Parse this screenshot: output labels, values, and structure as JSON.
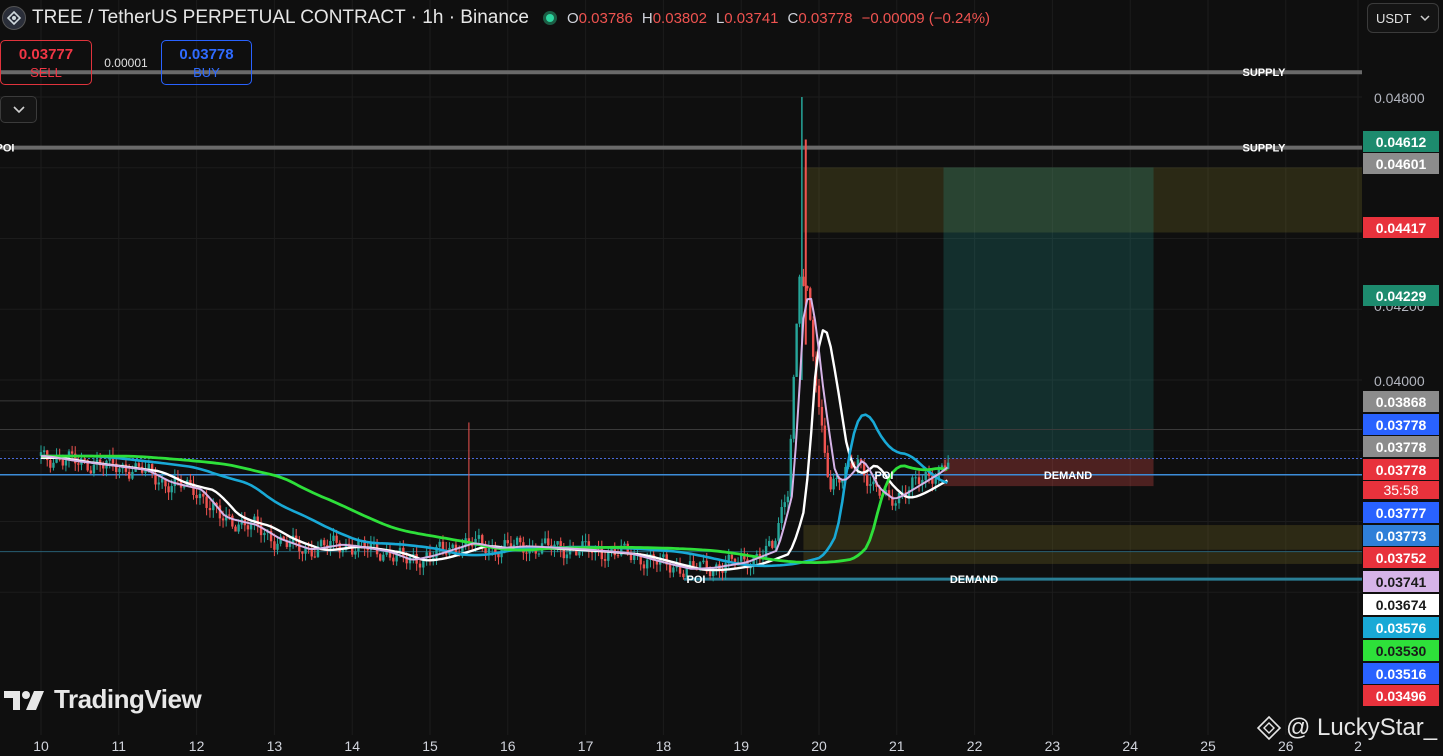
{
  "header": {
    "title": "TREE / TetherUS PERPETUAL CONTRACT · 1h · Binance",
    "ohlc": [
      {
        "key": "O",
        "value": "0.03786"
      },
      {
        "key": "H",
        "value": "0.03802"
      },
      {
        "key": "L",
        "value": "0.03741"
      },
      {
        "key": "C",
        "value": "0.03778"
      }
    ],
    "change": "−0.00009 (−0.24%)",
    "currency": "USDT"
  },
  "trade": {
    "sell_price": "0.03777",
    "sell_label": "SELL",
    "buy_price": "0.03778",
    "buy_label": "BUY",
    "spread": "0.00001"
  },
  "branding": {
    "logo_text": "TradingView",
    "watermark": "@ LuckyStar_"
  },
  "countdown": "35:58",
  "price_labels": [
    {
      "value": "0.04612",
      "bg": "#1d8b6e",
      "fg": "#ffffff"
    },
    {
      "value": "0.04601",
      "bg": "#8c8c8c",
      "fg": "#ffffff"
    },
    {
      "value": "0.04417",
      "bg": "#e8323c",
      "fg": "#ffffff"
    },
    {
      "value": "0.04229",
      "bg": "#1d8b6e",
      "fg": "#ffffff"
    },
    {
      "value": "0.03868",
      "bg": "#8c8c8c",
      "fg": "#ffffff"
    },
    {
      "value": "0.03778",
      "bg": "#2962ff",
      "fg": "#ffffff"
    },
    {
      "value": "0.03778",
      "bg": "#8c8c8c",
      "fg": "#ffffff"
    },
    {
      "value": "0.03778",
      "bg": "#e8323c",
      "fg": "#ffffff"
    },
    {
      "value": "0.03777",
      "bg": "#2962ff",
      "fg": "#ffffff"
    },
    {
      "value": "0.03773",
      "bg": "#2f7fd8",
      "fg": "#ffffff"
    },
    {
      "value": "0.03752",
      "bg": "#e8323c",
      "fg": "#ffffff"
    },
    {
      "value": "0.03741",
      "bg": "#d6b4e8",
      "fg": "#1a1a1a"
    },
    {
      "value": "0.03674",
      "bg": "#ffffff",
      "fg": "#1a1a1a"
    },
    {
      "value": "0.03576",
      "bg": "#19a9d6",
      "fg": "#ffffff"
    },
    {
      "value": "0.03530",
      "bg": "#2ee03a",
      "fg": "#1a1a1a"
    },
    {
      "value": "0.03516",
      "bg": "#2962ff",
      "fg": "#ffffff"
    },
    {
      "value": "0.03496",
      "bg": "#e8323c",
      "fg": "#ffffff"
    }
  ],
  "chart_data": {
    "type": "candlestick",
    "symbol": "TREE / TetherUS PERPETUAL CONTRACT",
    "interval": "1h",
    "exchange": "Binance",
    "y_ticks": [
      "0.04800",
      "0.04200",
      "0.04000"
    ],
    "x_ticks": [
      "10",
      "11",
      "12",
      "13",
      "14",
      "15",
      "16",
      "17",
      "18",
      "19",
      "20",
      "21",
      "22",
      "23",
      "24",
      "25",
      "26",
      "2"
    ],
    "ylim": [
      0.0345,
      0.0485
    ],
    "close_series": [
      {
        "day": 10.0,
        "price": 0.03785
      },
      {
        "day": 10.4,
        "price": 0.0377
      },
      {
        "day": 10.8,
        "price": 0.0376
      },
      {
        "day": 11.3,
        "price": 0.03745
      },
      {
        "day": 11.6,
        "price": 0.0371
      },
      {
        "day": 12.0,
        "price": 0.0369
      },
      {
        "day": 12.3,
        "price": 0.0361
      },
      {
        "day": 12.7,
        "price": 0.0359
      },
      {
        "day": 13.0,
        "price": 0.0355
      },
      {
        "day": 13.4,
        "price": 0.0352
      },
      {
        "day": 13.8,
        "price": 0.03535
      },
      {
        "day": 14.0,
        "price": 0.0353
      },
      {
        "day": 14.4,
        "price": 0.03515
      },
      {
        "day": 14.7,
        "price": 0.0349
      },
      {
        "day": 15.0,
        "price": 0.03505
      },
      {
        "day": 15.5,
        "price": 0.0354
      },
      {
        "day": 15.8,
        "price": 0.03525
      },
      {
        "day": 16.2,
        "price": 0.0353
      },
      {
        "day": 16.6,
        "price": 0.03525
      },
      {
        "day": 17.0,
        "price": 0.0352
      },
      {
        "day": 17.5,
        "price": 0.0351
      },
      {
        "day": 18.0,
        "price": 0.0348
      },
      {
        "day": 18.3,
        "price": 0.03465
      },
      {
        "day": 18.6,
        "price": 0.0347
      },
      {
        "day": 19.0,
        "price": 0.03485
      },
      {
        "day": 19.4,
        "price": 0.0352
      },
      {
        "day": 19.6,
        "price": 0.037
      },
      {
        "day": 19.75,
        "price": 0.043
      },
      {
        "day": 19.85,
        "price": 0.0423
      },
      {
        "day": 20.0,
        "price": 0.0392
      },
      {
        "day": 20.15,
        "price": 0.037
      },
      {
        "day": 20.3,
        "price": 0.0372
      },
      {
        "day": 20.5,
        "price": 0.0378
      },
      {
        "day": 20.7,
        "price": 0.0369
      },
      {
        "day": 20.9,
        "price": 0.0366
      },
      {
        "day": 21.2,
        "price": 0.037
      },
      {
        "day": 21.5,
        "price": 0.0374
      },
      {
        "day": 21.7,
        "price": 0.03778
      }
    ],
    "moving_averages": [
      {
        "color": "#ffffff",
        "last": "0.03674"
      },
      {
        "color": "#19a9d6",
        "last": "0.03576"
      },
      {
        "color": "#2ee03a",
        "last": "0.03530"
      },
      {
        "color": "#d6b4e8",
        "last": "0.03741"
      }
    ],
    "annotations": [
      {
        "text": "SUPPLY",
        "price": 0.0487
      },
      {
        "text": "SUPPLY",
        "price": 0.04657
      },
      {
        "text": "POI",
        "price": 0.04657
      },
      {
        "text": "POI",
        "price": 0.03732
      },
      {
        "text": "DEMAND",
        "price": 0.03732
      },
      {
        "text": "POI",
        "price": 0.03437
      },
      {
        "text": "DEMAND",
        "price": 0.03437
      }
    ],
    "zones": [
      {
        "kind": "supply",
        "from_day": 19.8,
        "to_day": 27.0,
        "price_low": 0.04417,
        "price_high": 0.04601
      },
      {
        "kind": "demand",
        "from_day": 19.8,
        "to_day": 27.0,
        "price_low": 0.0352,
        "price_high": 0.0359
      },
      {
        "kind": "demand",
        "from_day": 19.8,
        "to_day": 27.0,
        "price_low": 0.0348,
        "price_high": 0.03516
      }
    ],
    "position": {
      "side": "long",
      "entry": 0.03778,
      "target": 0.04601,
      "stop": 0.03741,
      "from_day": 21.6,
      "to_day": 24.3
    },
    "current_price": "0.03778"
  }
}
